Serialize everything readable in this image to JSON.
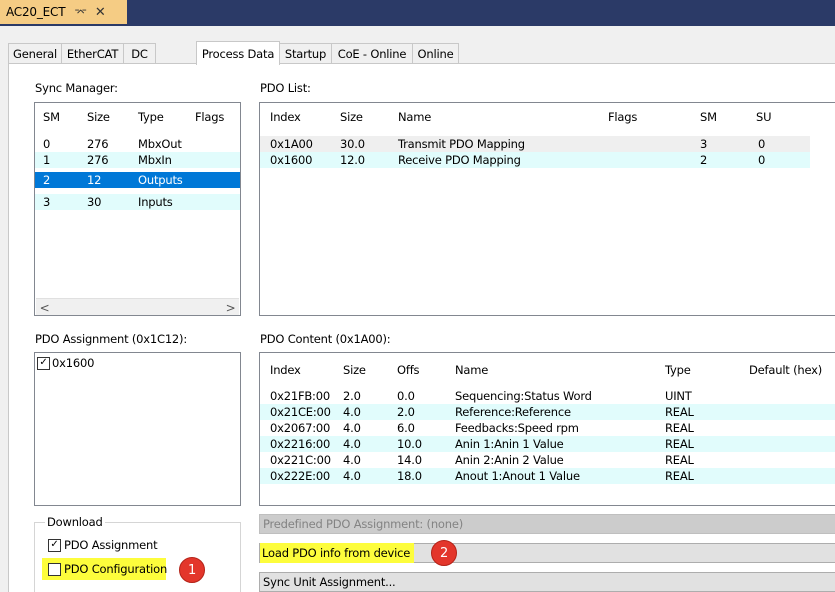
{
  "window": {
    "tab_title": "AC20_ECT",
    "pin_glyph": "⌤",
    "close_glyph": "✕"
  },
  "tabs": [
    {
      "label": "General",
      "active": false
    },
    {
      "label": "EtherCAT",
      "active": false
    },
    {
      "label": "DC",
      "active": false
    },
    {
      "label": "Process Data",
      "active": true
    },
    {
      "label": "Startup",
      "active": false
    },
    {
      "label": "CoE - Online",
      "active": false
    },
    {
      "label": "Online",
      "active": false
    }
  ],
  "sync_manager": {
    "label": "Sync Manager:",
    "columns": [
      "SM",
      "Size",
      "Type",
      "Flags"
    ],
    "rows": [
      {
        "sm": "0",
        "size": "276",
        "type": "MbxOut",
        "flags": ""
      },
      {
        "sm": "1",
        "size": "276",
        "type": "MbxIn",
        "flags": ""
      },
      {
        "sm": "2",
        "size": "12",
        "type": "Outputs",
        "flags": ""
      },
      {
        "sm": "3",
        "size": "30",
        "type": "Inputs",
        "flags": ""
      }
    ],
    "selected_index": 2,
    "scroll_left": "<",
    "scroll_right": ">"
  },
  "pdo_list": {
    "label": "PDO List:",
    "columns": [
      "Index",
      "Size",
      "Name",
      "Flags",
      "SM",
      "SU"
    ],
    "rows": [
      {
        "index": "0x1A00",
        "size": "30.0",
        "name": "Transmit PDO Mapping",
        "flags": "",
        "sm": "3",
        "su": "0"
      },
      {
        "index": "0x1600",
        "size": "12.0",
        "name": "Receive PDO Mapping",
        "flags": "",
        "sm": "2",
        "su": "0"
      }
    ]
  },
  "pdo_assignment": {
    "label": "PDO Assignment (0x1C12):",
    "items": [
      {
        "label": "0x1600",
        "checked": true,
        "mark": "✓"
      }
    ]
  },
  "pdo_content": {
    "label": "PDO Content (0x1A00):",
    "columns": [
      "Index",
      "Size",
      "Offs",
      "Name",
      "Type",
      "Default (hex)"
    ],
    "rows": [
      {
        "index": "0x21FB:00",
        "size": "2.0",
        "offs": "0.0",
        "name": "Sequencing:Status Word",
        "type": "UINT",
        "default": ""
      },
      {
        "index": "0x21CE:00",
        "size": "4.0",
        "offs": "2.0",
        "name": "Reference:Reference",
        "type": "REAL",
        "default": ""
      },
      {
        "index": "0x2067:00",
        "size": "4.0",
        "offs": "6.0",
        "name": "Feedbacks:Speed rpm",
        "type": "REAL",
        "default": ""
      },
      {
        "index": "0x2216:00",
        "size": "4.0",
        "offs": "10.0",
        "name": "Anin 1:Anin 1 Value",
        "type": "REAL",
        "default": ""
      },
      {
        "index": "0x221C:00",
        "size": "4.0",
        "offs": "14.0",
        "name": "Anin 2:Anin 2 Value",
        "type": "REAL",
        "default": ""
      },
      {
        "index": "0x222E:00",
        "size": "4.0",
        "offs": "18.0",
        "name": "Anout 1:Anout 1 Value",
        "type": "REAL",
        "default": ""
      }
    ]
  },
  "download": {
    "title": "Download",
    "pdo_assignment": {
      "label": "PDO Assignment",
      "checked": true,
      "mark": "✓"
    },
    "pdo_configuration": {
      "label": "PDO Configuration",
      "checked": false,
      "mark": ""
    }
  },
  "buttons": {
    "predefined": "Predefined PDO Assignment: (none)",
    "load_pdo": "Load PDO info from device",
    "sync_unit": "Sync Unit Assignment..."
  },
  "callouts": {
    "one": "1",
    "two": "2"
  },
  "colors": {
    "title_bar": "#2b3a67",
    "doc_tab": "#f5cc84",
    "selection": "#0078d7",
    "alt_row": "#e1fcfc",
    "highlight": "#fdfd3c",
    "badge": "#e3362b"
  }
}
